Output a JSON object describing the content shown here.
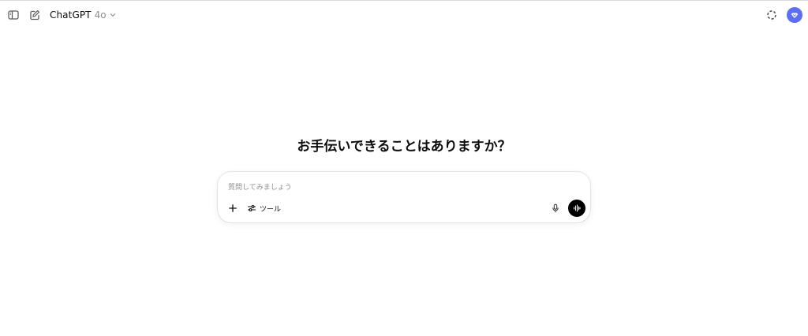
{
  "header": {
    "model_name": "ChatGPT",
    "model_version": "4o",
    "icons": {
      "sidebar_toggle": "sidebar-toggle-icon",
      "new_chat": "new-chat-icon",
      "model_menu": "chevron-down-icon",
      "temporary_chat": "temporary-chat-icon",
      "account": "avatar"
    }
  },
  "main": {
    "headline": "お手伝いできることはありますか？"
  },
  "composer": {
    "placeholder": "質問してみましょう",
    "value": "",
    "tools_label": "ツール",
    "icons": {
      "add": "plus-icon",
      "tools": "sliders-icon",
      "dictate": "microphone-icon",
      "voice_mode": "voice-waveform-icon"
    }
  },
  "colors": {
    "background": "#ffffff",
    "text": "#0d0d0d",
    "muted_text": "#8f8f8f",
    "avatar": "#5b6ef5",
    "voice_button": "#000000",
    "composer_border": "#e3e3e3"
  }
}
